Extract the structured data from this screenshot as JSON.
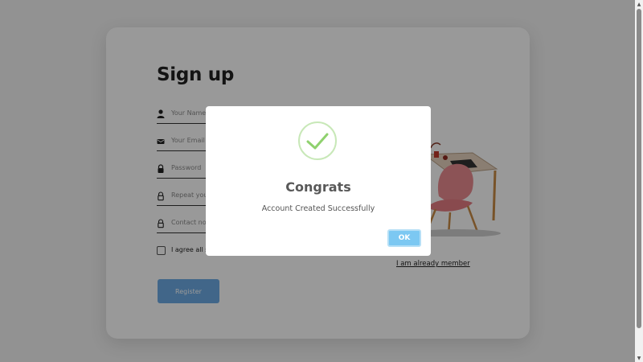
{
  "signup": {
    "title": "Sign up",
    "fields": [
      {
        "icon": "person-icon",
        "placeholder": "Your Name"
      },
      {
        "icon": "email-icon",
        "placeholder": "Your Email"
      },
      {
        "icon": "lock-icon",
        "placeholder": "Password"
      },
      {
        "icon": "lock-outline-icon",
        "placeholder": "Repeat your password"
      },
      {
        "icon": "lock-outline-icon",
        "placeholder": "Contact no"
      }
    ],
    "agree_label": "I agree all statements in Terms of service",
    "register_label": "Register",
    "already_member": "I am already member"
  },
  "modal": {
    "title": "Congrats",
    "message": "Account Created Successfully",
    "ok_label": "OK",
    "icon": "check-icon"
  },
  "colors": {
    "register_button": "#6dabe4",
    "ok_button": "#7cc8f2",
    "success_check": "#8fd16e"
  }
}
